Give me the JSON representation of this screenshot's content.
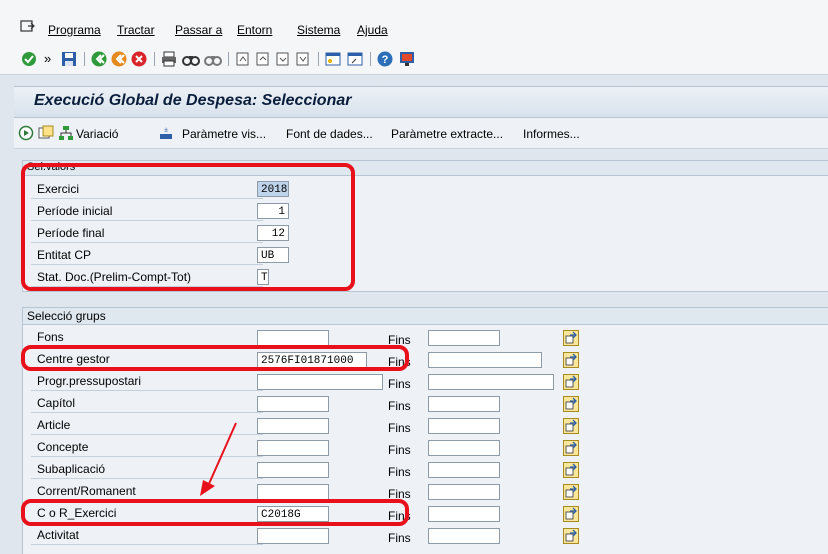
{
  "menubar": {
    "items": [
      "Programa",
      "Tractar",
      "Passar a",
      "Entorn",
      "Sistema",
      "Ajuda"
    ]
  },
  "screen": {
    "title": "Execució Global de Despesa: Seleccionar"
  },
  "app_toolbar": {
    "variant_label": "Variació",
    "buttons": [
      "Paràmetre vis...",
      "Font de dades...",
      "Paràmetre extracte...",
      "Informes..."
    ]
  },
  "sel_valors": {
    "title": "Sel.valors",
    "rows": [
      {
        "label": "Exercici",
        "value": "2018"
      },
      {
        "label": "Període inicial",
        "value": "1"
      },
      {
        "label": "Període final",
        "value": "12"
      },
      {
        "label": "Entitat CP",
        "value": "UB"
      },
      {
        "label": "Stat. Doc.(Prelim-Compt-Tot)",
        "value": "T"
      }
    ]
  },
  "seleccio_grups": {
    "title": "Selecció grups",
    "to_label": "Fins",
    "rows": [
      {
        "label": "Fons",
        "from": "",
        "to": ""
      },
      {
        "label": "Centre gestor",
        "from": "2576FI01871000",
        "to": ""
      },
      {
        "label": "Progr.pressupostari",
        "from": "",
        "to": ""
      },
      {
        "label": "Capítol",
        "from": "",
        "to": ""
      },
      {
        "label": "Article",
        "from": "",
        "to": ""
      },
      {
        "label": "Concepte",
        "from": "",
        "to": ""
      },
      {
        "label": "Subaplicació",
        "from": "",
        "to": ""
      },
      {
        "label": "Corrent/Romanent",
        "from": "",
        "to": ""
      },
      {
        "label": "C o R_Exercici",
        "from": "C2018G",
        "to": ""
      },
      {
        "label": "Activitat",
        "from": "",
        "to": ""
      }
    ]
  },
  "colors": {
    "highlight": "#e8111b",
    "title": "#0a1e3c",
    "multiple_selection_button": "#fbe79a"
  },
  "icons": [
    "enter-icon",
    "save-icon",
    "back-icon",
    "exit-icon",
    "cancel-icon",
    "print-icon",
    "find-icon",
    "help-icon",
    "execute-icon",
    "multiple-selection-icon"
  ]
}
